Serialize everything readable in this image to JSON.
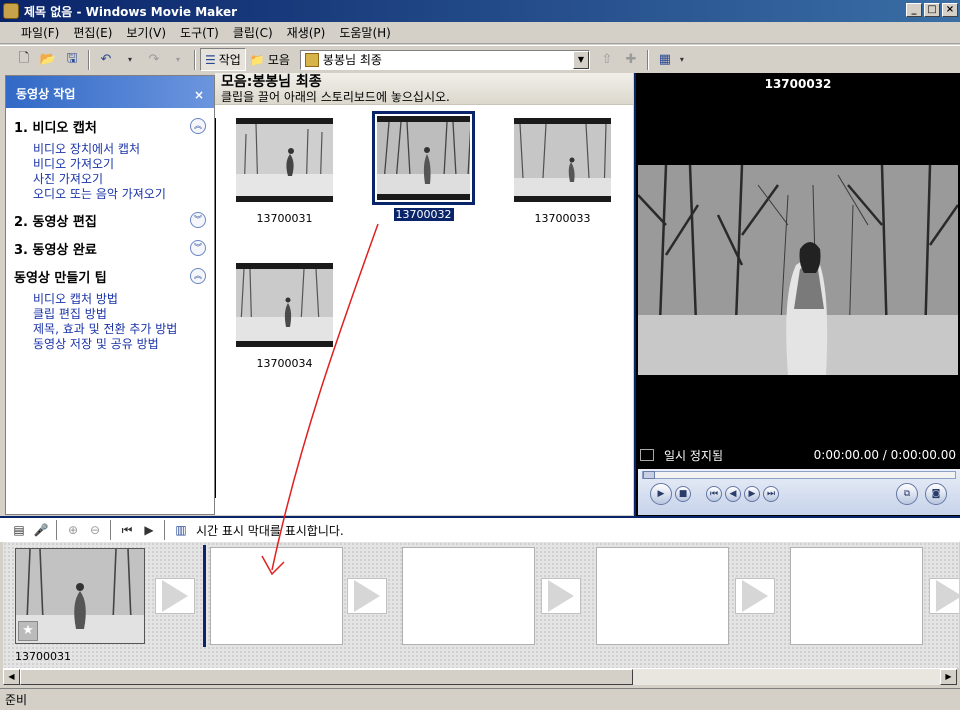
{
  "window": {
    "title": "제목 없음 - Windows Movie Maker"
  },
  "menu": [
    "파일(F)",
    "편집(E)",
    "보기(V)",
    "도구(T)",
    "클립(C)",
    "재생(P)",
    "도움말(H)"
  ],
  "toolbar": {
    "tasks_label": "작업",
    "collections_label": "모음",
    "collection_value": "봉봉님 최종"
  },
  "tasks": {
    "header": "동영상 작업",
    "sections": [
      {
        "label": "1. 비디오 캡처",
        "state": "expanded",
        "links": [
          "비디오 장치에서 캡처",
          "비디오 가져오기",
          "사진 가져오기",
          "오디오 또는 음악 가져오기"
        ]
      },
      {
        "label": "2. 동영상 편집",
        "state": "collapsed",
        "links": []
      },
      {
        "label": "3. 동영상 완료",
        "state": "collapsed",
        "links": []
      },
      {
        "label": "동영상 만들기 팁",
        "state": "expanded",
        "links": [
          "비디오 캡처 방법",
          "클립 편집 방법",
          "제목, 효과 및 전환 추가 방법",
          "동영상 저장 및 공유 방법"
        ]
      }
    ]
  },
  "collection": {
    "title": "모음:봉봉님 최종",
    "subtitle": "클립을 끌어 아래의 스토리보드에 놓으십시오.",
    "clips": [
      "13700031",
      "13700032",
      "13700033",
      "13700034"
    ],
    "selected_clip": "13700032"
  },
  "monitor": {
    "title": "13700032",
    "status": "일시 정지됨",
    "time": "0:00:00.00 / 0:00:00.00"
  },
  "storyboard": {
    "toolbar_message": "시간 표시 막대를 표시합니다.",
    "clips": [
      "13700031"
    ]
  },
  "statusbar": {
    "text": "준비"
  },
  "colors": {
    "title_bar": "#0a246a",
    "link": "#1a33a8",
    "task_header": "#3169c6",
    "annotation_arrow": "#e02020"
  }
}
